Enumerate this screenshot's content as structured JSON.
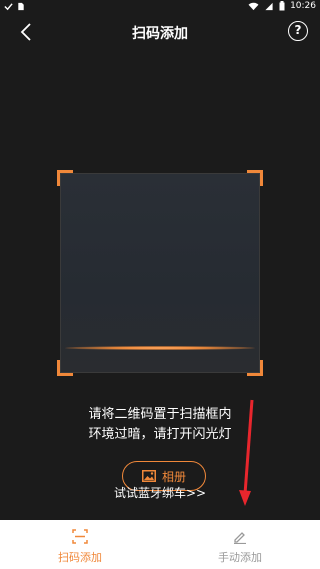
{
  "status_bar": {
    "time": "10:26"
  },
  "header": {
    "title": "扫码添加",
    "help_label": "?"
  },
  "hint": {
    "line1": "请将二维码置于扫描框内",
    "line2": "环境过暗，请打开闪光灯"
  },
  "album_button": {
    "label": "相册"
  },
  "bluetooth_link": {
    "label": "试试蓝牙绑车>>"
  },
  "tabs": [
    {
      "label": "扫码添加",
      "icon": "scan-icon",
      "active": true
    },
    {
      "label": "手动添加",
      "icon": "pencil-icon",
      "active": false
    }
  ],
  "colors": {
    "accent": "#f0883a",
    "annotation_arrow": "#e8262d",
    "background": "#1b1b1b"
  }
}
